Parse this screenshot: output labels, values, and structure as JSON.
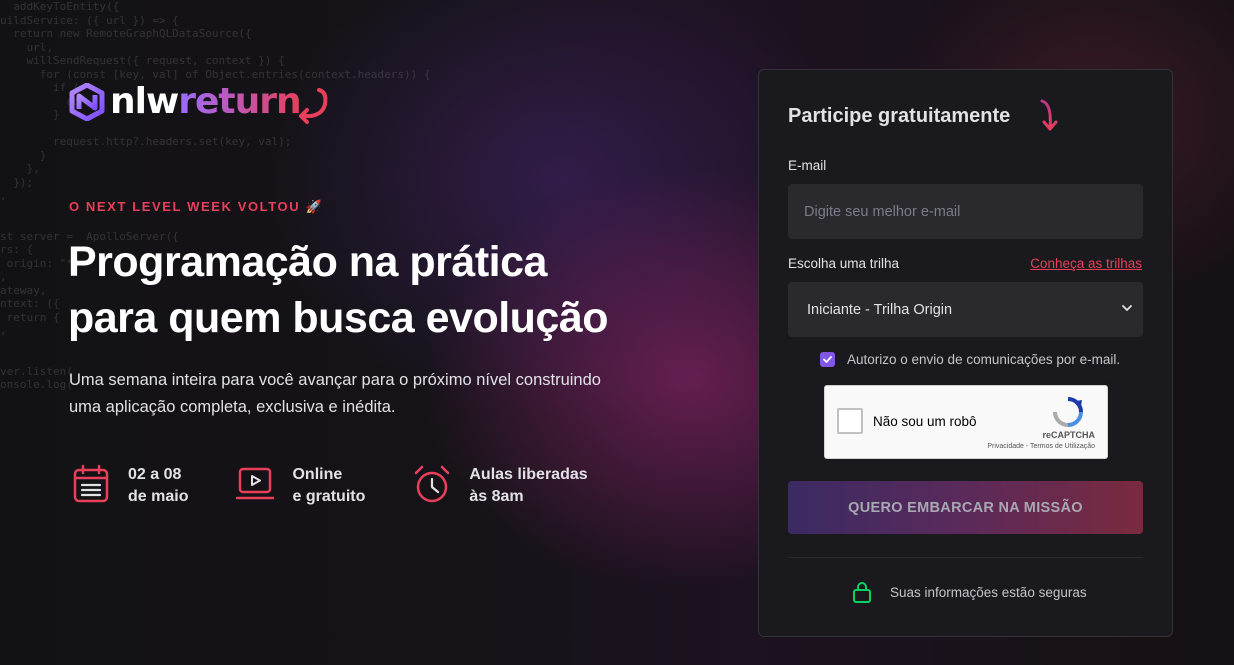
{
  "background_code": "  addKeyToEntity({\nuildService: ({ url }) => {\n  return new RemoteGraphQLDataSource({\n    url,\n    willSendRequest({ request, context }) {\n      for (const [key, val] of Object.entries(context.headers)) {\n        if (\n          co\n        }\n\n        request.http?.headers.set(key, val);\n      }\n    },\n  });\n,\n\n\nst server =  ApolloServer({\nrs: {\n origin: \"*\"\n,\nateway,\nntext: ({\n return {\n,\n\n\nver.listen(\nonsole.log(",
  "logo": {
    "nlw": "nlw",
    "return": "return",
    "colors": {
      "purple": "#996dff",
      "red": "#e83f5b"
    }
  },
  "hero": {
    "eyebrow": "O NEXT LEVEL WEEK VOLTOU 🚀",
    "title_line1": "Programação na prática",
    "title_line2": "para quem busca evolução",
    "subtitle": "Uma semana inteira para você avançar para o próximo nível construindo uma aplicação completa, exclusiva e inédita."
  },
  "features": [
    {
      "icon": "calendar-icon",
      "line1": "02 a 08",
      "line2": "de maio"
    },
    {
      "icon": "laptop-play-icon",
      "line1": "Online",
      "line2": "e gratuito"
    },
    {
      "icon": "alarm-clock-icon",
      "line1": "Aulas liberadas",
      "line2": "às 8am"
    }
  ],
  "form": {
    "title": "Participe gratuitamente",
    "email_label": "E-mail",
    "email_placeholder": "Digite seu melhor e-mail",
    "email_value": "",
    "track_label": "Escolha uma trilha",
    "track_link": "Conheça as trilhas",
    "track_selected": "Iniciante - Trilha Origin",
    "consent_label": "Autorizo o envio de comunicações por e-mail.",
    "consent_checked": true,
    "recaptcha": {
      "label": "Não sou um robô",
      "brand": "reCAPTCHA",
      "terms": "Privacidade - Termos de Utilização"
    },
    "submit_label": "QUERO EMBARCAR NA MISSÃO",
    "secure_text": "Suas informações estão seguras"
  },
  "colors": {
    "accent_red": "#e83f5b",
    "accent_purple": "#8257e5",
    "secure_green": "#04d361"
  }
}
